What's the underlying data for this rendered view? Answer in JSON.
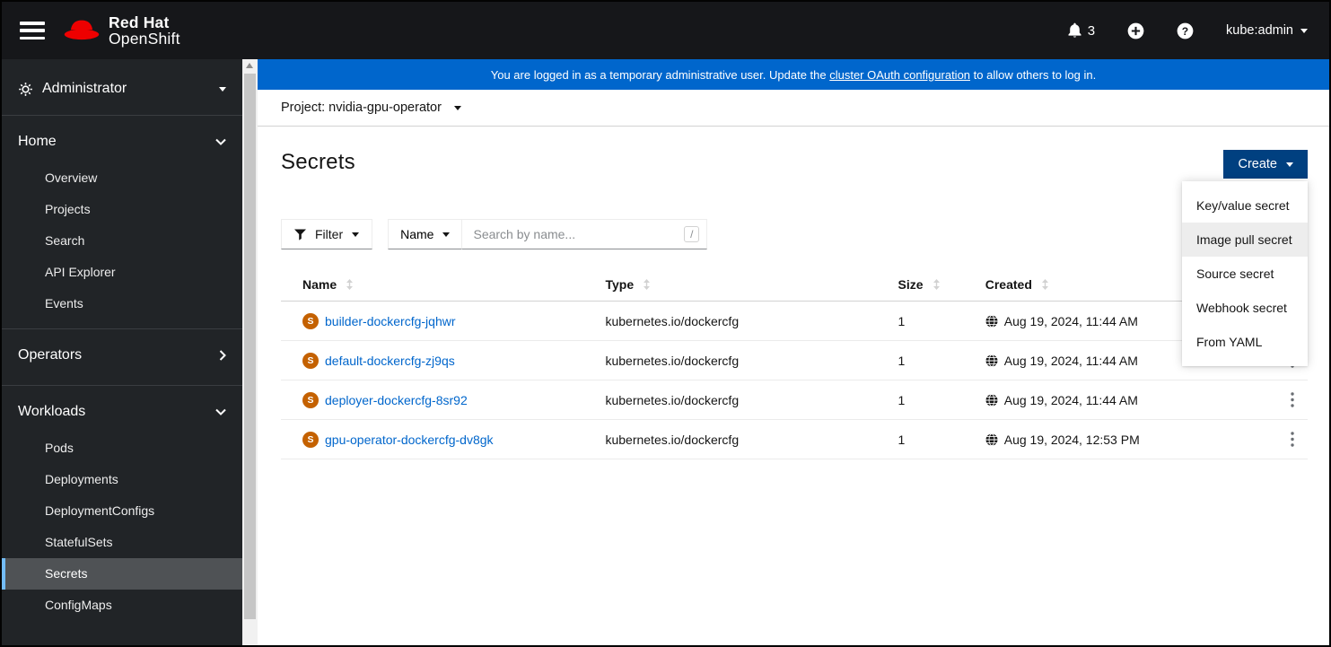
{
  "masthead": {
    "brand_line1": "Red Hat",
    "brand_line2": "OpenShift",
    "notification_count": "3",
    "username": "kube:admin"
  },
  "banner": {
    "text_before": "You are logged in as a temporary administrative user. Update the ",
    "link_text": "cluster OAuth configuration",
    "text_after": " to allow others to log in."
  },
  "project_bar": {
    "label": "Project: nvidia-gpu-operator"
  },
  "sidebar": {
    "perspective": "Administrator",
    "sections": [
      {
        "label": "Home",
        "items": [
          "Overview",
          "Projects",
          "Search",
          "API Explorer",
          "Events"
        ]
      },
      {
        "label": "Operators",
        "items": []
      },
      {
        "label": "Workloads",
        "items": [
          "Pods",
          "Deployments",
          "DeploymentConfigs",
          "StatefulSets",
          "Secrets",
          "ConfigMaps"
        ],
        "active_item": "Secrets"
      }
    ]
  },
  "page": {
    "title": "Secrets",
    "create_label": "Create",
    "create_menu": [
      "Key/value secret",
      "Image pull secret",
      "Source secret",
      "Webhook secret",
      "From YAML"
    ],
    "create_menu_hovered": "Image pull secret"
  },
  "toolbar": {
    "filter_label": "Filter",
    "name_label": "Name",
    "search_placeholder": "Search by name...",
    "search_value": "",
    "search_shortcut": "/"
  },
  "table": {
    "columns": [
      "Name",
      "Type",
      "Size",
      "Created"
    ],
    "badge_letter": "S",
    "rows": [
      {
        "name": "builder-dockercfg-jqhwr",
        "type": "kubernetes.io/dockercfg",
        "size": "1",
        "created": "Aug 19, 2024, 11:44 AM"
      },
      {
        "name": "default-dockercfg-zj9qs",
        "type": "kubernetes.io/dockercfg",
        "size": "1",
        "created": "Aug 19, 2024, 11:44 AM"
      },
      {
        "name": "deployer-dockercfg-8sr92",
        "type": "kubernetes.io/dockercfg",
        "size": "1",
        "created": "Aug 19, 2024, 11:44 AM"
      },
      {
        "name": "gpu-operator-dockercfg-dv8gk",
        "type": "kubernetes.io/dockercfg",
        "size": "1",
        "created": "Aug 19, 2024, 12:53 PM"
      }
    ]
  },
  "colors": {
    "banner_blue": "#0066cc",
    "create_button": "#004080",
    "link": "#0066cc",
    "secret_badge": "#c46100",
    "active_nav_border": "#73bcf7",
    "masthead_bg": "#16171a",
    "sidebar_bg": "#212427",
    "brand_red": "#ee0000"
  }
}
